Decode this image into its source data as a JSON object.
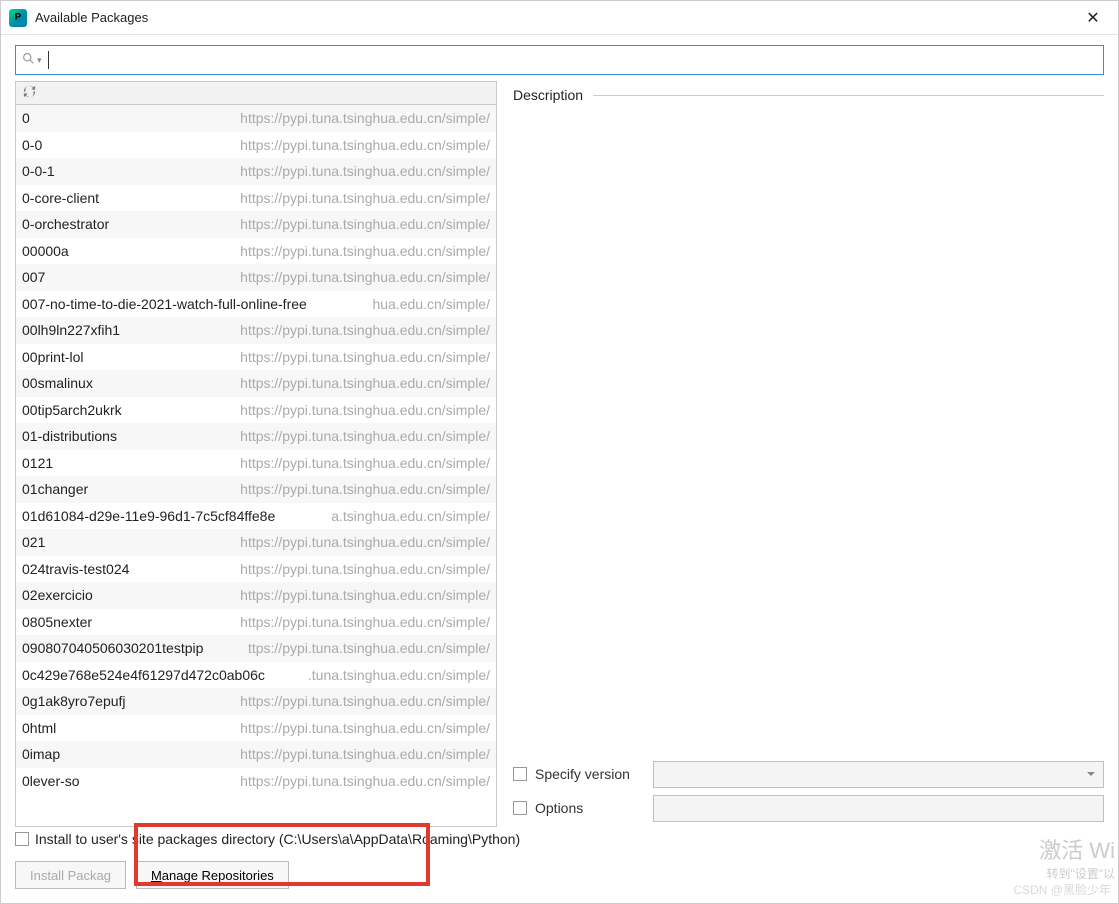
{
  "window": {
    "title": "Available Packages"
  },
  "search": {
    "value": ""
  },
  "description": {
    "label": "Description"
  },
  "packages": [
    {
      "name": "0",
      "src": "https://pypi.tuna.tsinghua.edu.cn/simple/"
    },
    {
      "name": "0-0",
      "src": "https://pypi.tuna.tsinghua.edu.cn/simple/"
    },
    {
      "name": "0-0-1",
      "src": "https://pypi.tuna.tsinghua.edu.cn/simple/"
    },
    {
      "name": "0-core-client",
      "src": "https://pypi.tuna.tsinghua.edu.cn/simple/"
    },
    {
      "name": "0-orchestrator",
      "src": "https://pypi.tuna.tsinghua.edu.cn/simple/"
    },
    {
      "name": "00000a",
      "src": "https://pypi.tuna.tsinghua.edu.cn/simple/"
    },
    {
      "name": "007",
      "src": "https://pypi.tuna.tsinghua.edu.cn/simple/"
    },
    {
      "name": "007-no-time-to-die-2021-watch-full-online-free",
      "src": "hua.edu.cn/simple/"
    },
    {
      "name": "00lh9ln227xfih1",
      "src": "https://pypi.tuna.tsinghua.edu.cn/simple/"
    },
    {
      "name": "00print-lol",
      "src": "https://pypi.tuna.tsinghua.edu.cn/simple/"
    },
    {
      "name": "00smalinux",
      "src": "https://pypi.tuna.tsinghua.edu.cn/simple/"
    },
    {
      "name": "00tip5arch2ukrk",
      "src": "https://pypi.tuna.tsinghua.edu.cn/simple/"
    },
    {
      "name": "01-distributions",
      "src": "https://pypi.tuna.tsinghua.edu.cn/simple/"
    },
    {
      "name": "0121",
      "src": "https://pypi.tuna.tsinghua.edu.cn/simple/"
    },
    {
      "name": "01changer",
      "src": "https://pypi.tuna.tsinghua.edu.cn/simple/"
    },
    {
      "name": "01d61084-d29e-11e9-96d1-7c5cf84ffe8e",
      "src": "a.tsinghua.edu.cn/simple/"
    },
    {
      "name": "021",
      "src": "https://pypi.tuna.tsinghua.edu.cn/simple/"
    },
    {
      "name": "024travis-test024",
      "src": "https://pypi.tuna.tsinghua.edu.cn/simple/"
    },
    {
      "name": "02exercicio",
      "src": "https://pypi.tuna.tsinghua.edu.cn/simple/"
    },
    {
      "name": "0805nexter",
      "src": "https://pypi.tuna.tsinghua.edu.cn/simple/"
    },
    {
      "name": "090807040506030201testpip",
      "src": "ttps://pypi.tuna.tsinghua.edu.cn/simple/"
    },
    {
      "name": "0c429e768e524e4f61297d472c0ab06c",
      "src": ".tuna.tsinghua.edu.cn/simple/"
    },
    {
      "name": "0g1ak8yro7epufj",
      "src": "https://pypi.tuna.tsinghua.edu.cn/simple/"
    },
    {
      "name": "0html",
      "src": "https://pypi.tuna.tsinghua.edu.cn/simple/"
    },
    {
      "name": "0imap",
      "src": "https://pypi.tuna.tsinghua.edu.cn/simple/"
    },
    {
      "name": "0lever-so",
      "src": "https://pypi.tuna.tsinghua.edu.cn/simple/"
    }
  ],
  "options": {
    "specify_version_label": "Specify version",
    "options_label": "Options"
  },
  "install_user": {
    "label": "Install to user's site packages directory (C:\\Users\\a\\AppData\\Roaming\\Python)"
  },
  "buttons": {
    "install_package": "Install Packag",
    "manage_repos_prefix": "M",
    "manage_repos_rest": "anage Repositories"
  },
  "watermark": {
    "big": "激活 Wi",
    "small": "转到\"设置\"以"
  },
  "csdn": "CSDN @黑脸少年"
}
